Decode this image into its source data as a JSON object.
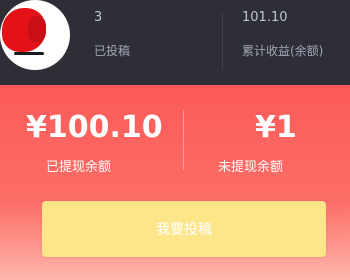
{
  "header": {
    "avatar": {
      "icon": "user-avatar"
    },
    "stats": [
      {
        "value": "3",
        "label": "已投稿"
      },
      {
        "value": "101.10",
        "label": "累计收益(余额)"
      }
    ]
  },
  "balance": {
    "withdrawn": {
      "amount": "¥100.10",
      "label": "已提现余额"
    },
    "pending": {
      "amount": "¥1",
      "label": "未提现余额"
    }
  },
  "cta": {
    "label": "我要投稿"
  },
  "colors": {
    "header_bg": "#2e2e37",
    "card_gradient_top": "#fb5a58",
    "card_gradient_bottom": "#ffb6ad",
    "button_bg": "#fde58a"
  }
}
